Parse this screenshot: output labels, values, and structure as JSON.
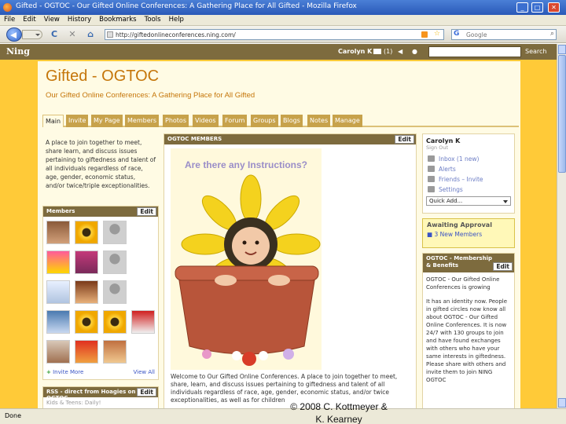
{
  "window": {
    "title": "Gifted - OGTOC - Our Gifted Online Conferences: A Gathering Place for All Gifted - Mozilla Firefox",
    "min": "_",
    "max": "□",
    "close": "✕"
  },
  "menubar": {
    "items": [
      "File",
      "Edit",
      "View",
      "History",
      "Bookmarks",
      "Tools",
      "Help"
    ]
  },
  "toolbar": {
    "reload": "C",
    "stop": "✕",
    "home": "⌂",
    "url": "http://giftedonlineconferences.ning.com/",
    "search_placeholder": "Google",
    "search_icon": "⌕"
  },
  "ning": {
    "logo": "Ning",
    "user": "Carolyn K",
    "inbox_count": "(1)",
    "search_button": "Search"
  },
  "site": {
    "title": "Gifted - OGTOC",
    "tagline": "Our Gifted Online Conferences: A Gathering Place for All Gifted"
  },
  "tabs": [
    "Main",
    "Invite",
    "My Page",
    "Members",
    "Photos",
    "Videos",
    "Forum",
    "Groups",
    "Blogs",
    "Notes",
    "Manage"
  ],
  "intro": {
    "text": "A place to join together to meet, share learn, and discuss issues pertaining to giftedness and talent of all individuals regardless of race, age, gender, economic status, and/or twice/triple exceptionalities."
  },
  "members": {
    "title": "Members",
    "edit": "Edit",
    "invite_more": "Invite More",
    "view_all": "View All"
  },
  "rss": {
    "title": "RSS - direct from Hoagies on OGTOC",
    "edit": "Edit",
    "item": "Kids & Teens: Daily!"
  },
  "main_box": {
    "title": "OGTOC MEMBERS",
    "edit": "Edit",
    "poster_text": "Are there any Instructions?",
    "welcome": "Welcome to Our Gifted Online Conferences. A place to join together to meet, share, learn, and discuss issues pertaining to giftedness and talent of all individuals regardless of race, age, gender, economic status, and/or twice exceptionalities, as well as for children"
  },
  "profile": {
    "name": "Carolyn K",
    "sign_out": "Sign Out",
    "links": [
      {
        "label": "Inbox (1 new)",
        "icon": "inbox-icon"
      },
      {
        "label": "Alerts",
        "icon": "alerts-icon"
      },
      {
        "label": "Friends – Invite",
        "icon": "friends-icon"
      },
      {
        "label": "Settings",
        "icon": "settings-icon"
      }
    ],
    "quick_add": "Quick Add..."
  },
  "approval": {
    "title": "Awaiting Approval",
    "item": "3 New Members"
  },
  "benefits": {
    "title": "OGTOC - Membership & Benefits",
    "edit": "Edit",
    "headline": "OGTOC - Our Gifted Online Conferences is growing",
    "body": "It has an identity now. People in gifted circles now know all about OGTOC - Our Gifted Online Conferences. It is now 24/7 with 130 groups to join and have found exchanges with others who have your same interests in giftedness. Please share with others and invite them to join NING OGTOC"
  },
  "status": {
    "text": "Done"
  },
  "copyright": {
    "line1": "© 2008 C. Kottmeyer &",
    "line2": "K. Kearney"
  },
  "colors": {
    "page_bg": "#ffca38",
    "header_brown": "#7d6b3e",
    "title_orange": "#c5760a",
    "link_blue": "#3a54c4"
  }
}
